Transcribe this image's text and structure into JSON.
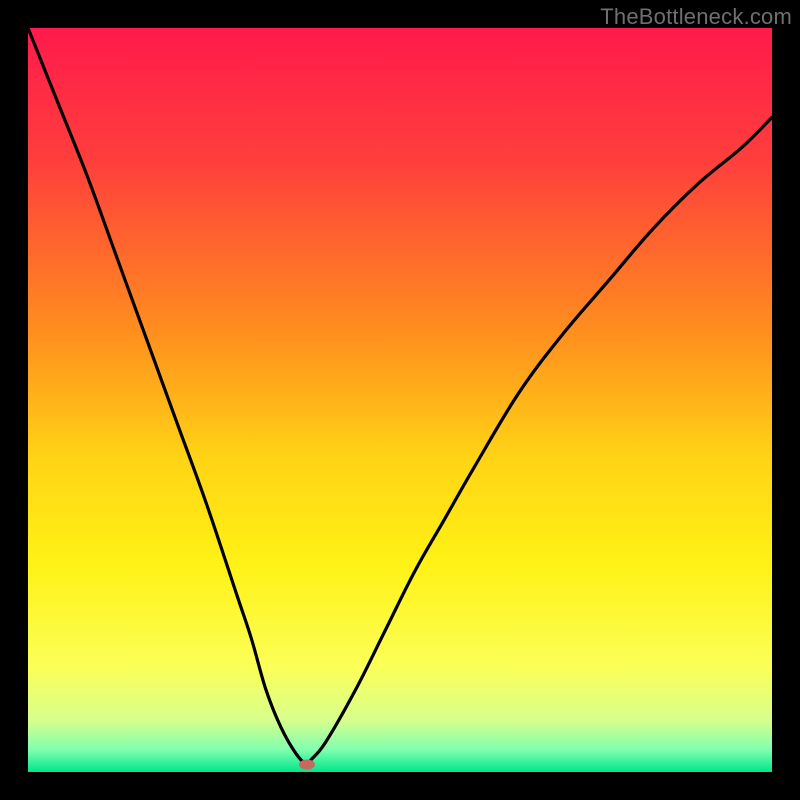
{
  "watermark": "TheBottleneck.com",
  "chart_data": {
    "type": "line",
    "title": "",
    "xlabel": "",
    "ylabel": "",
    "xlim": [
      0,
      100
    ],
    "ylim": [
      0,
      100
    ],
    "grid": false,
    "legend": false,
    "background_gradient_stops": [
      {
        "offset": 0.0,
        "color": "#ff1a4b"
      },
      {
        "offset": 0.18,
        "color": "#ff3f3c"
      },
      {
        "offset": 0.4,
        "color": "#ff8b1f"
      },
      {
        "offset": 0.58,
        "color": "#ffd415"
      },
      {
        "offset": 0.72,
        "color": "#fff215"
      },
      {
        "offset": 0.86,
        "color": "#fbff58"
      },
      {
        "offset": 0.93,
        "color": "#d8ff8c"
      },
      {
        "offset": 0.97,
        "color": "#7fffb0"
      },
      {
        "offset": 1.0,
        "color": "#00e68a"
      }
    ],
    "series": [
      {
        "name": "bottleneck-curve",
        "x": [
          0,
          4,
          8,
          12,
          16,
          20,
          24,
          28,
          30,
          32,
          34,
          36,
          37.5,
          38,
          40,
          44,
          48,
          52,
          56,
          60,
          66,
          72,
          78,
          84,
          90,
          96,
          100
        ],
        "y": [
          100,
          90,
          80,
          69,
          58,
          47,
          36,
          24,
          18,
          11,
          6,
          2.5,
          1,
          1.6,
          4,
          11,
          19,
          27,
          34,
          41,
          51,
          59,
          66,
          73,
          79,
          84,
          88
        ]
      }
    ],
    "marker": {
      "x": 37.5,
      "y": 1.0,
      "color": "#c46a5e",
      "rx": 8,
      "ry": 5
    }
  }
}
